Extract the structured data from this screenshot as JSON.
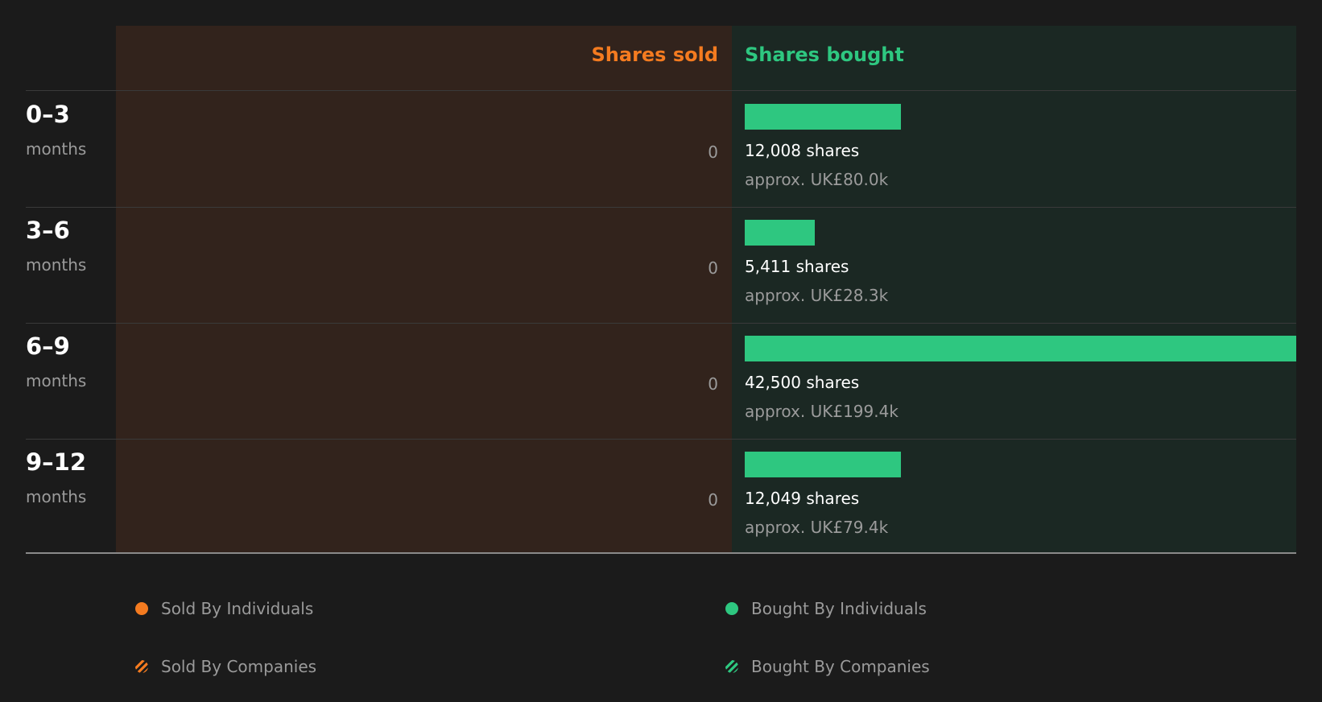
{
  "colors": {
    "sold": "#f47b20",
    "bought": "#2ec780",
    "sold_panel": "#32231c",
    "bought_panel": "#1b2823"
  },
  "headers": {
    "sold": "Shares sold",
    "bought": "Shares bought"
  },
  "chart_data": {
    "type": "bar",
    "categories": [
      "0–3 months",
      "3–6 months",
      "6–9 months",
      "9–12 months"
    ],
    "series": [
      {
        "name": "Shares sold",
        "values": [
          0,
          0,
          0,
          0
        ]
      },
      {
        "name": "Shares bought",
        "values": [
          12008,
          5411,
          42500,
          12049
        ]
      }
    ],
    "approx_value_gbp": [
      "UK£80.0k",
      "UK£28.3k",
      "UK£199.4k",
      "UK£79.4k"
    ]
  },
  "rows": [
    {
      "range": "0–3",
      "unit": "months",
      "sold": "0",
      "bought_shares": "12,008 shares",
      "bought_approx": "approx. UK£80.0k"
    },
    {
      "range": "3–6",
      "unit": "months",
      "sold": "0",
      "bought_shares": "5,411 shares",
      "bought_approx": "approx. UK£28.3k"
    },
    {
      "range": "6–9",
      "unit": "months",
      "sold": "0",
      "bought_shares": "42,500 shares",
      "bought_approx": "approx. UK£199.4k"
    },
    {
      "range": "9–12",
      "unit": "months",
      "sold": "0",
      "bought_shares": "12,049 shares",
      "bought_approx": "approx. UK£79.4k"
    }
  ],
  "legend": [
    {
      "label": "Sold By Individuals",
      "style": "dot",
      "color": "#f47b20"
    },
    {
      "label": "Bought By Individuals",
      "style": "dot",
      "color": "#2ec780"
    },
    {
      "label": "Sold By Companies",
      "style": "hatch",
      "color": "#f47b20"
    },
    {
      "label": "Bought By Companies",
      "style": "hatch",
      "color": "#2ec780"
    }
  ]
}
